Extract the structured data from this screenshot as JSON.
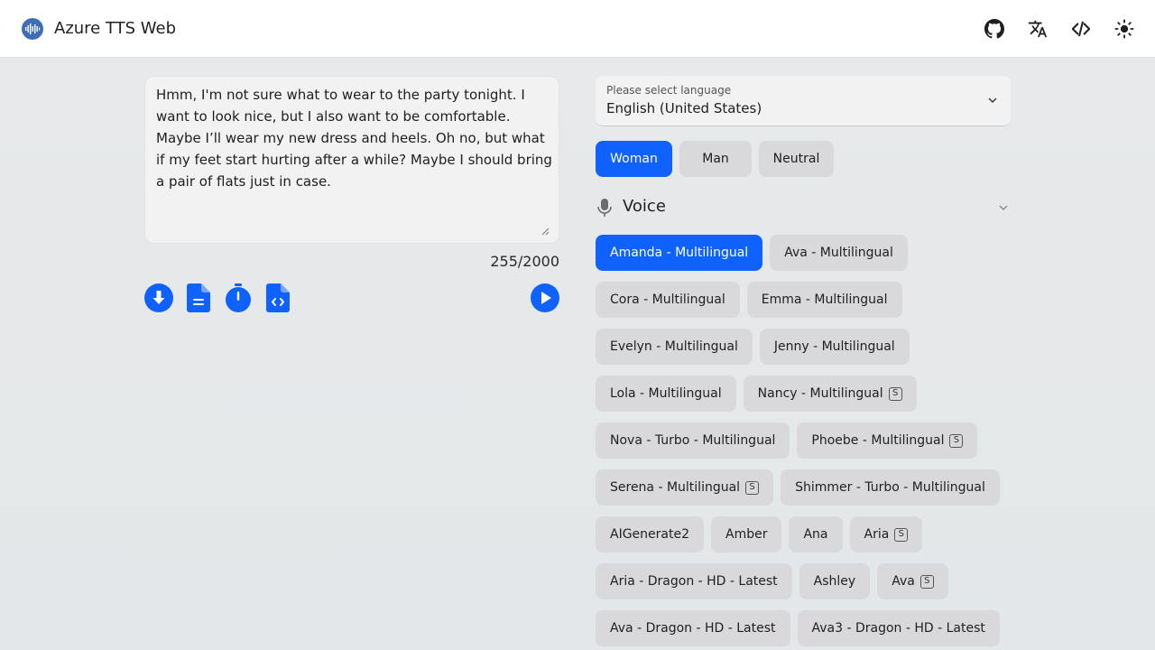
{
  "app": {
    "title": "Azure TTS Web"
  },
  "topbar_icons": [
    "github-icon",
    "translate-icon",
    "code-icon",
    "sun-icon"
  ],
  "editor": {
    "text": "Hmm, I'm not sure what to wear to the party tonight. I want to look nice, but I also want to be comfortable. Maybe I’ll wear my new dress and heels. Oh no, but what if my feet start hurting after a while? Maybe I should bring a pair of flats just in case.",
    "char_count": "255/2000"
  },
  "actions": [
    "download-icon",
    "document-icon",
    "timer-icon",
    "code-file-icon",
    "play-icon"
  ],
  "language": {
    "label": "Please select language",
    "value": "English (United States)"
  },
  "gender": {
    "options": [
      "Woman",
      "Man",
      "Neutral"
    ],
    "selected": "Woman"
  },
  "voice": {
    "title": "Voice",
    "selected": "Amanda - Multilingual",
    "items": [
      {
        "label": "Amanda - Multilingual",
        "badge": ""
      },
      {
        "label": "Ava - Multilingual",
        "badge": ""
      },
      {
        "label": "Cora - Multilingual",
        "badge": ""
      },
      {
        "label": "Emma - Multilingual",
        "badge": ""
      },
      {
        "label": "Evelyn - Multilingual",
        "badge": ""
      },
      {
        "label": "Jenny - Multilingual",
        "badge": ""
      },
      {
        "label": "Lola - Multilingual",
        "badge": ""
      },
      {
        "label": "Nancy - Multilingual",
        "badge": "S"
      },
      {
        "label": "Nova - Turbo - Multilingual",
        "badge": ""
      },
      {
        "label": "Phoebe - Multilingual",
        "badge": "S"
      },
      {
        "label": "Serena - Multilingual",
        "badge": "S"
      },
      {
        "label": "Shimmer - Turbo - Multilingual",
        "badge": ""
      },
      {
        "label": "AIGenerate2",
        "badge": ""
      },
      {
        "label": "Amber",
        "badge": ""
      },
      {
        "label": "Ana",
        "badge": ""
      },
      {
        "label": "Aria",
        "badge": "S"
      },
      {
        "label": "Aria - Dragon - HD - Latest",
        "badge": ""
      },
      {
        "label": "Ashley",
        "badge": ""
      },
      {
        "label": "Ava",
        "badge": "S"
      },
      {
        "label": "Ava - Dragon - HD - Latest",
        "badge": ""
      },
      {
        "label": "Ava3 - Dragon - HD - Latest",
        "badge": ""
      }
    ]
  },
  "colors": {
    "accent": "#0f62fe",
    "chip": "#d9d9dc",
    "background": "#e9ebec"
  }
}
